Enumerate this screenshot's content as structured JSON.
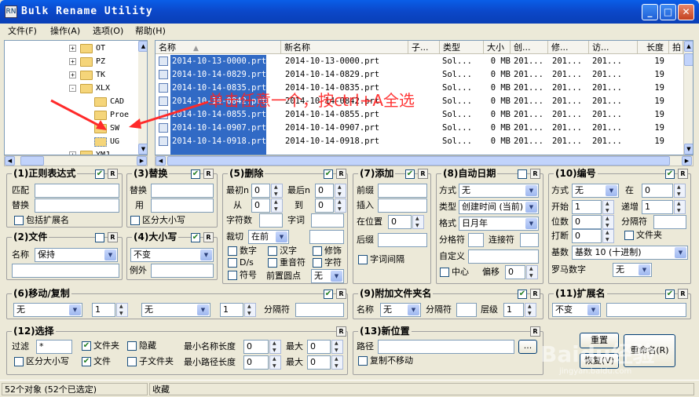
{
  "window": {
    "title": "Bulk Rename Utility",
    "app_icon": "RN",
    "accent": "#0a5ee8"
  },
  "menu": [
    "文件(F)",
    "操作(A)",
    "选项(O)",
    "帮助(H)"
  ],
  "tree": {
    "items": [
      {
        "label": "OT",
        "expander": "+"
      },
      {
        "label": "PZ",
        "expander": "+"
      },
      {
        "label": "TK",
        "expander": "+"
      },
      {
        "label": "XLX",
        "expander": "-"
      },
      {
        "label": "CAD",
        "expander": ""
      },
      {
        "label": "Proe",
        "expander": ""
      },
      {
        "label": "SW",
        "expander": ""
      },
      {
        "label": "UG",
        "expander": ""
      },
      {
        "label": "YMJ",
        "expander": "+"
      }
    ]
  },
  "list": {
    "columns": [
      "名称",
      "新名称",
      "子...",
      "类型",
      "大小",
      "创...",
      "修...",
      "访...",
      "长度",
      "拍"
    ],
    "rows": [
      {
        "name": "2014-10-13-0000.prt",
        "new": "2014-10-13-0000.prt",
        "type": "Sol...",
        "size": "0 MB",
        "c": "201...",
        "m": "201...",
        "a": "201...",
        "len": "19"
      },
      {
        "name": "2014-10-14-0829.prt",
        "new": "2014-10-14-0829.prt",
        "type": "Sol...",
        "size": "0 MB",
        "c": "201...",
        "m": "201...",
        "a": "201...",
        "len": "19"
      },
      {
        "name": "2014-10-14-0835.prt",
        "new": "2014-10-14-0835.prt",
        "type": "Sol...",
        "size": "0 MB",
        "c": "201...",
        "m": "201...",
        "a": "201...",
        "len": "19"
      },
      {
        "name": "2014-10-14-0842.prt",
        "new": "2014-10-14-0842.prt",
        "type": "Sol...",
        "size": "0 MB",
        "c": "201...",
        "m": "201...",
        "a": "201...",
        "len": "19"
      },
      {
        "name": "2014-10-14-0855.prt",
        "new": "2014-10-14-0855.prt",
        "type": "Sol...",
        "size": "0 MB",
        "c": "201...",
        "m": "201...",
        "a": "201...",
        "len": "19"
      },
      {
        "name": "2014-10-14-0907.prt",
        "new": "2014-10-14-0907.prt",
        "type": "Sol...",
        "size": "0 MB",
        "c": "201...",
        "m": "201...",
        "a": "201...",
        "len": "19"
      },
      {
        "name": "2014-10-14-0918.prt",
        "new": "2014-10-14-0918.prt",
        "type": "Sol...",
        "size": "0 MB",
        "c": "201...",
        "m": "201...",
        "a": "201...",
        "len": "19"
      }
    ]
  },
  "annotation": "单击任意一个，按ctrl+A全选",
  "r_label": "R",
  "check_mark": "✔",
  "g1": {
    "title": "(1)正则表达式",
    "match": "匹配",
    "replace": "替换",
    "include_ext": "包括扩展名"
  },
  "g2": {
    "title": "(2)文件",
    "name_label": "名称",
    "name_value": "保持"
  },
  "g3": {
    "title": "(3)替换",
    "replace": "替换",
    "with": "用",
    "case": "区分大小写"
  },
  "g4": {
    "title": "(4)大小写",
    "value": "不变",
    "except": "例外"
  },
  "g5": {
    "title": "(5)删除",
    "first_n": "最初n",
    "last_n": "最后n",
    "from": "从",
    "to": "到",
    "chars": "字符数",
    "words": "字词",
    "crop": "裁切",
    "crop_value": "在前",
    "digits": "数字",
    "hanzi": "汉字",
    "trim": "修饰",
    "ds": "D/s",
    "accent": "重音符",
    "chars2": "字符",
    "symbols": "符号",
    "lead_dots": "前置圆点",
    "lead_value": "无",
    "zero": "0"
  },
  "g6": {
    "title": "(6)移动/复制",
    "mode1": "无",
    "n1": "1",
    "mode2": "无",
    "n2": "1",
    "sep": "分隔符"
  },
  "g7": {
    "title": "(7)添加",
    "prefix": "前缀",
    "insert": "插入",
    "at_pos": "在位置",
    "pos": "0",
    "suffix": "后缀",
    "word_space": "字词间隔"
  },
  "g8": {
    "title": "(8)自动日期",
    "mode": "方式",
    "mode_value": "无",
    "type": "类型",
    "type_value": "创建时间 (当前)",
    "format": "格式",
    "format_value": "日月年",
    "sep": "分格符",
    "connector": "连接符",
    "custom": "自定义",
    "center": "中心",
    "offset": "偏移",
    "offset_value": "0"
  },
  "g9": {
    "title": "(9)附加文件夹名",
    "name": "名称",
    "name_value": "无",
    "sep": "分隔符",
    "level": "层级",
    "level_value": "1"
  },
  "g10": {
    "title": "(10)编号",
    "mode": "方式",
    "mode_value": "无",
    "at": "在",
    "at_value": "0",
    "start": "开始",
    "start_value": "1",
    "incr": "递增",
    "incr_value": "1",
    "pad": "位数",
    "pad_value": "0",
    "sep": "分隔符",
    "break": "打断",
    "break_value": "0",
    "folder": "文件夹",
    "base": "基数",
    "base_value": "基数 10 (十进制)",
    "roman": "罗马数字",
    "roman_value": "无"
  },
  "g11": {
    "title": "(11)扩展名",
    "value": "不变"
  },
  "g12": {
    "title": "(12)选择",
    "filter": "过滤",
    "filter_value": "*",
    "folders": "文件夹",
    "hidden": "隐藏",
    "min_name": "最小名称长度",
    "max": "最大",
    "case": "区分大小写",
    "files": "文件",
    "subfolders": "子文件夹",
    "min_path": "最小路径长度",
    "zero": "0"
  },
  "g13": {
    "title": "(13)新位置",
    "path": "路径",
    "browse": "...",
    "copy_no_move": "复制不移动"
  },
  "buttons": {
    "reset": "重置",
    "revert": "恢复(V)",
    "rename": "重命名(R)"
  },
  "watermark": {
    "brand": "Baidu经验",
    "url": "jingyan.baidu.com"
  },
  "status": {
    "count": "52个对象 (52个已选定)",
    "fav": "收藏"
  }
}
